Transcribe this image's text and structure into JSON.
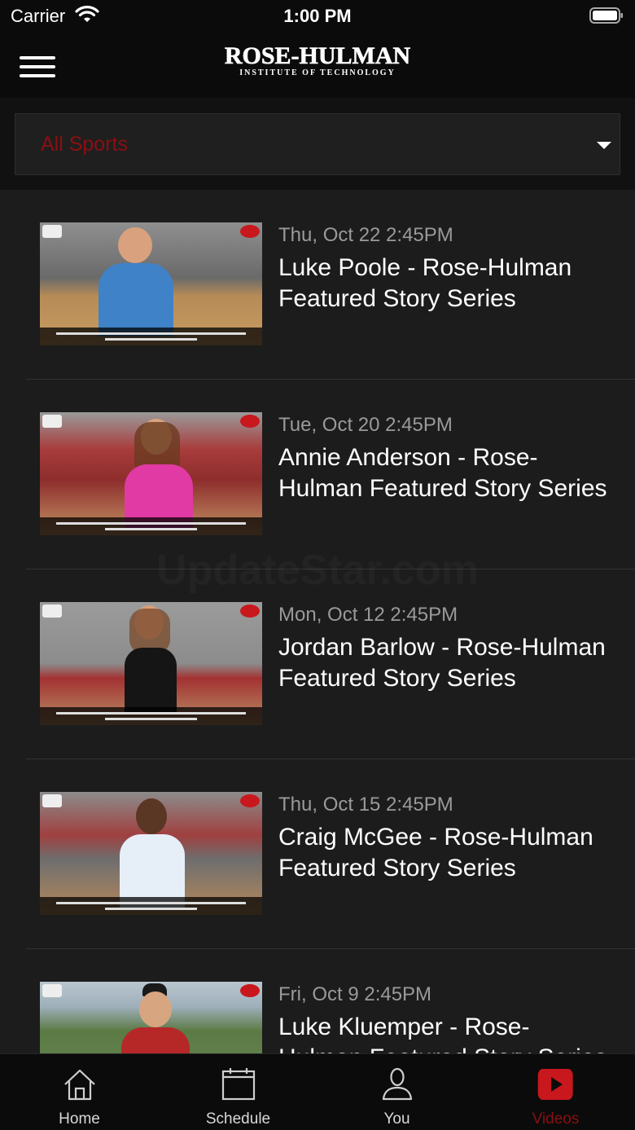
{
  "status_bar": {
    "carrier": "Carrier",
    "time": "1:00 PM"
  },
  "header": {
    "logo_title": "ROSE-HULMAN",
    "logo_subtitle": "INSTITUTE OF TECHNOLOGY",
    "menu_icon": "hamburger-icon"
  },
  "filter": {
    "selected": "All Sports",
    "accent_color": "#8a0f12"
  },
  "videos": [
    {
      "date": "Thu, Oct 22 2:45PM",
      "title": "Luke Poole - Rose-Hulman Featured Story Series"
    },
    {
      "date": "Tue, Oct 20 2:45PM",
      "title": "Annie Anderson - Rose-Hulman Featured Story Series"
    },
    {
      "date": "Mon, Oct 12 2:45PM",
      "title": "Jordan Barlow - Rose-Hulman Featured Story Series"
    },
    {
      "date": "Thu, Oct 15 2:45PM",
      "title": "Craig McGee - Rose-Hulman Featured Story Series"
    },
    {
      "date": "Fri, Oct 9 2:45PM",
      "title": "Luke Kluemper - Rose-Hulman Featured Story Series"
    }
  ],
  "watermark": "UpdateStar.com",
  "tabs": [
    {
      "label": "Home",
      "icon": "home-icon"
    },
    {
      "label": "Schedule",
      "icon": "calendar-icon"
    },
    {
      "label": "You",
      "icon": "person-icon"
    },
    {
      "label": "Videos",
      "icon": "video-play-icon",
      "active": true
    }
  ],
  "colors": {
    "background": "#1c1c1c",
    "bar_background": "#0b0b0b",
    "active_tab": "#8a0f12",
    "video_icon_red": "#c8171d"
  }
}
